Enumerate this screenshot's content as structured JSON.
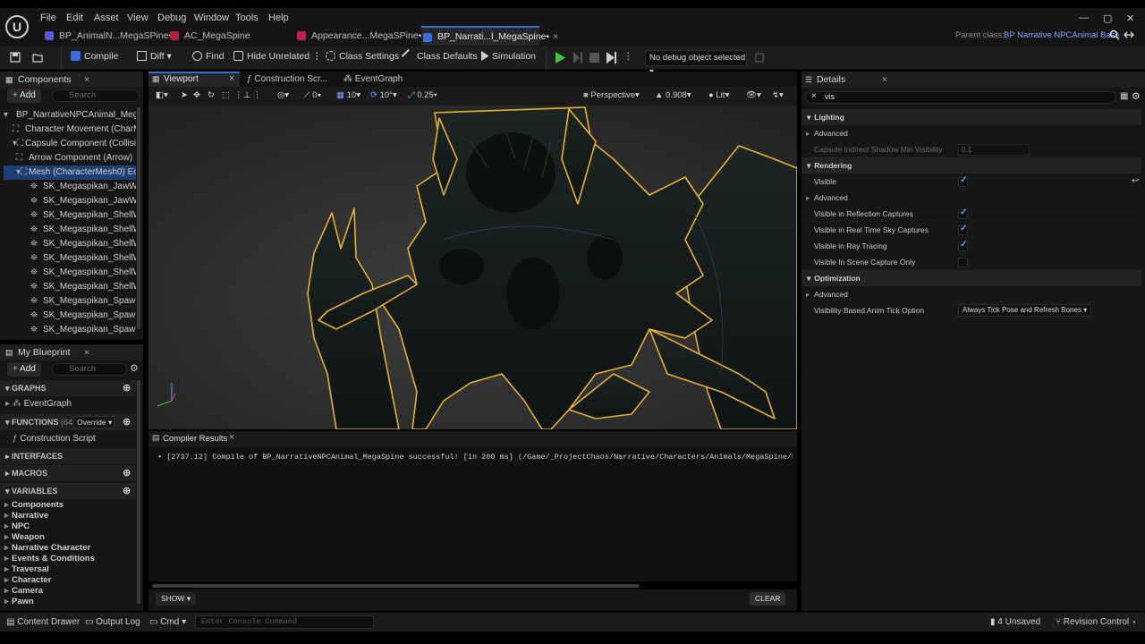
{
  "menu": [
    "File",
    "Edit",
    "Asset",
    "View",
    "Debug",
    "Window",
    "Tools",
    "Help"
  ],
  "tabs": [
    {
      "label": "BP_AnimalN...MegaSPine•",
      "color": "#5a5ad8"
    },
    {
      "label": "AC_MegaSpine",
      "color": "#b02040"
    },
    {
      "label": "Appearance...MegaSPine•",
      "color": "#c02050"
    },
    {
      "label": "BP_Narrati...l_MegaSpine•",
      "color": "#3b6cdb"
    }
  ],
  "tab_close": "×",
  "parent_class": {
    "label": "Parent class:",
    "value": "BP Narrative NPCAnimal Base"
  },
  "toolbar": {
    "compile": "Compile",
    "diff": "Diff",
    "find": "Find",
    "hide_unrelated": "Hide Unrelated",
    "class_settings": "Class Settings",
    "class_defaults": "Class Defaults",
    "simulation": "Simulation",
    "debug_object": "No debug object selected"
  },
  "components": {
    "title": "Components",
    "add": "Add",
    "search_placeholder": "Search",
    "items": [
      {
        "label": "BP_NarrativeNPCAnimal_MegaSp",
        "indent": 0,
        "selected": false
      },
      {
        "label": "Character Movement (CharM",
        "indent": 1,
        "selected": false
      },
      {
        "label": "Capsule Component (Collisior",
        "indent": 1,
        "selected": false
      },
      {
        "label": "Arrow Component (Arrow)",
        "indent": 2,
        "selected": false
      },
      {
        "label": "Mesh (CharacterMesh0)  Ec",
        "indent": 2,
        "selected": true
      },
      {
        "label": "SK_Megaspikan_JawWea",
        "indent": 3,
        "selected": false
      },
      {
        "label": "SK_Megaspikan_JawWea",
        "indent": 3,
        "selected": false
      },
      {
        "label": "SK_Megaspikan_ShellWe",
        "indent": 3,
        "selected": false
      },
      {
        "label": "SK_Megaspikan_ShellWe",
        "indent": 3,
        "selected": false
      },
      {
        "label": "SK_Megaspikan_ShellWe",
        "indent": 3,
        "selected": false
      },
      {
        "label": "SK_Megaspikan_ShellWe",
        "indent": 3,
        "selected": false
      },
      {
        "label": "SK_Megaspikan_ShellWe",
        "indent": 3,
        "selected": false
      },
      {
        "label": "SK_Megaspikan_ShellWe",
        "indent": 3,
        "selected": false
      },
      {
        "label": "SK_Megaspikan_Spawne",
        "indent": 3,
        "selected": false
      },
      {
        "label": "SK_Megaspikan_Spawne",
        "indent": 3,
        "selected": false
      },
      {
        "label": "SK_Megaspikan_Spawne",
        "indent": 3,
        "selected": false
      }
    ]
  },
  "myblueprint": {
    "title": "My Blueprint",
    "add": "Add",
    "search_placeholder": "Search",
    "graphs_label": "GRAPHS",
    "event_graph": "EventGraph",
    "functions_label": "FUNCTIONS",
    "functions_count": "(64 OV",
    "override": "Override",
    "construction_script": "Construction Script",
    "interfaces_label": "INTERFACES",
    "macros_label": "MACROS",
    "variables_label": "VARIABLES",
    "categories": [
      "Components",
      "Narrative",
      "NPC",
      "Weapon",
      "Narrative Character",
      "Events & Conditions",
      "Traversal",
      "Character",
      "Camera",
      "Pawn"
    ]
  },
  "editor_tabs": {
    "viewport": "Viewport",
    "construction": "Construction Scr...",
    "eventgraph": "EventGraph"
  },
  "viewport_bar": {
    "rot": "0",
    "fov": "10",
    "angle": "10°",
    "scale": "0.25",
    "perspective": "Perspective",
    "speed": "0.908",
    "lit": "Lit"
  },
  "compiler": {
    "title": "Compiler Results",
    "message": "[2737.12] Compile of BP_NarrativeNPCAnimal_MegaSpine successful! [in 200 ms] (/Game/_ProjectChaos/Narrative/Characters/Animals/MegaSpine/BP_NarrativeNP",
    "show": "SHOW",
    "clear": "CLEAR"
  },
  "details": {
    "title": "Details",
    "search": "vis",
    "rows": [
      {
        "type": "section",
        "label": "Lighting"
      },
      {
        "type": "sub",
        "label": "Advanced"
      },
      {
        "type": "text",
        "label": "Capsule Indirect Shadow Min Visibility",
        "value": "0.1",
        "dim": true
      },
      {
        "type": "section",
        "label": "Rendering"
      },
      {
        "type": "check",
        "label": "Visible",
        "checked": true
      },
      {
        "type": "sub",
        "label": "Advanced"
      },
      {
        "type": "check",
        "label": "Visible in Reflection Captures",
        "checked": true
      },
      {
        "type": "check",
        "label": "Visible in Real Time Sky Captures",
        "checked": true
      },
      {
        "type": "check",
        "label": "Visible in Ray Tracing",
        "checked": true
      },
      {
        "type": "check",
        "label": "Visible In Scene Capture Only",
        "checked": false
      },
      {
        "type": "section",
        "label": "Optimization"
      },
      {
        "type": "sub",
        "label": "Advanced"
      },
      {
        "type": "combo",
        "label": "Visibility Based Anim Tick Option",
        "value": "Always Tick Pose and Refresh Bones"
      }
    ]
  },
  "statusbar": {
    "content_drawer": "Content Drawer",
    "output_log": "Output Log",
    "cmd": "Cmd",
    "console_placeholder": "Enter Console Command",
    "unsaved": "4 Unsaved",
    "revision": "Revision Control"
  }
}
